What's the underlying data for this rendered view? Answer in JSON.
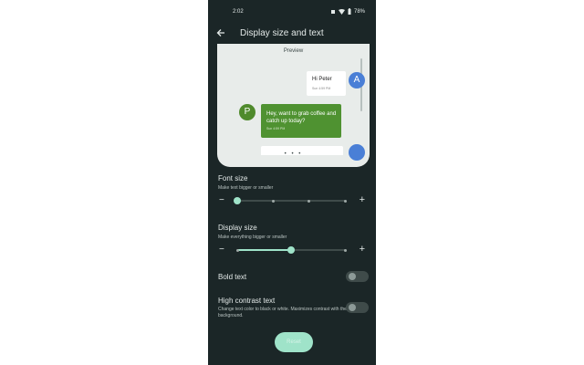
{
  "status_bar": {
    "time": "2:02",
    "battery": "78%"
  },
  "app_bar": {
    "title": "Display size and text",
    "back_icon": "arrow-left-icon"
  },
  "preview": {
    "label": "Preview",
    "outgoing": {
      "avatar": "A",
      "message": "Hi Peter",
      "time": "Sun 4:59 PM"
    },
    "incoming": {
      "avatar": "P",
      "message": "Hey, want to grab coffee and catch up today?",
      "time": "Sun 4:59 PM"
    },
    "pager": "• • •"
  },
  "font_size": {
    "title": "Font size",
    "subtitle": "Make text bigger or smaller",
    "minus_label": "−",
    "plus_label": "+",
    "steps": 4,
    "value_index": 0
  },
  "display_size": {
    "title": "Display size",
    "subtitle": "Make everything bigger or smaller",
    "minus_label": "−",
    "plus_label": "+",
    "steps": 3,
    "value_index": 1
  },
  "bold_text": {
    "title": "Bold text",
    "on": false
  },
  "high_contrast": {
    "title": "High contrast text",
    "subtitle": "Change text color to black or white. Maximizes contrast with the background.",
    "on": false
  },
  "reset_button": {
    "label": "Reset"
  },
  "colors": {
    "background": "#1b2627",
    "accent": "#9fe3c9",
    "preview_card": "#e8ecea"
  }
}
